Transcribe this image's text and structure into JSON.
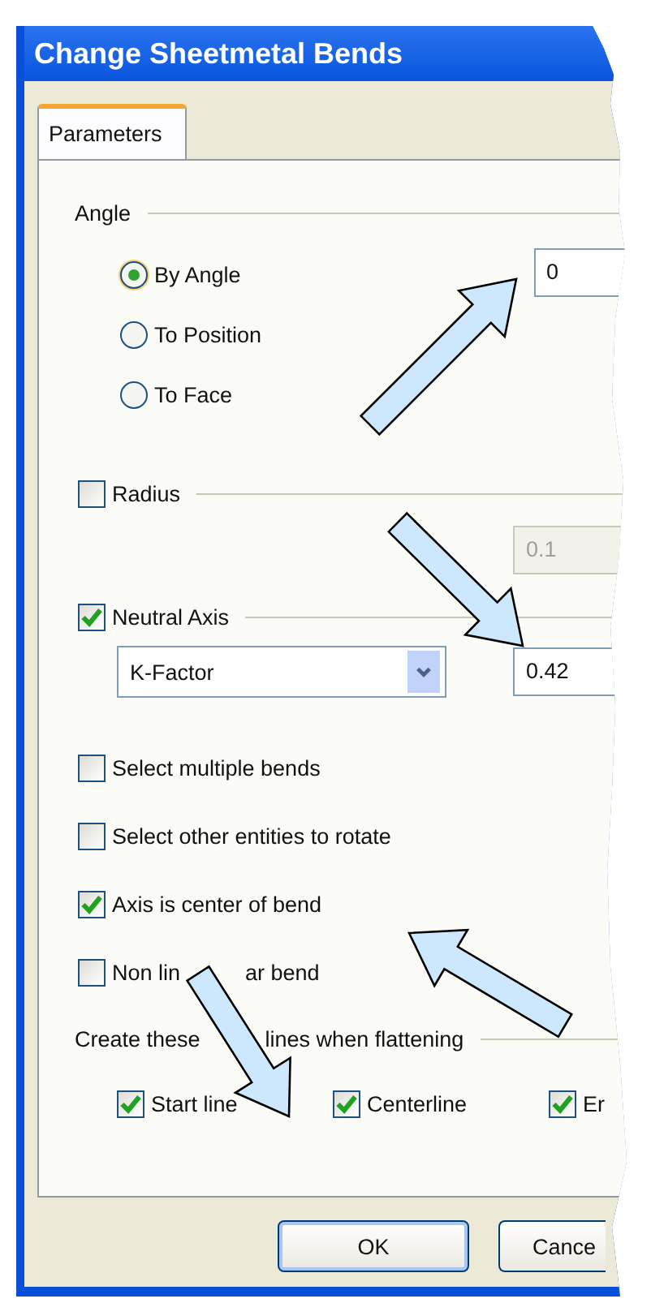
{
  "window": {
    "title": "Change Sheetmetal Bends"
  },
  "tabs": [
    {
      "label": "Parameters",
      "selected": true
    }
  ],
  "angle_group": {
    "title": "Angle",
    "value": "0",
    "options": [
      {
        "label": "By Angle",
        "selected": true
      },
      {
        "label": "To Position",
        "selected": false
      },
      {
        "label": "To Face",
        "selected": false
      }
    ]
  },
  "radius": {
    "label": "Radius",
    "checked": false,
    "value": "0.1",
    "disabled": true
  },
  "neutral_axis": {
    "label": "Neutral Axis",
    "checked": true,
    "method": "K-Factor",
    "value": "0.42"
  },
  "options": [
    {
      "label": [
        "Select multiple bends"
      ],
      "checked": false
    },
    {
      "label": [
        "Select other entities to rotate"
      ],
      "checked": false
    },
    {
      "label": [
        "Axis is center of bend"
      ],
      "checked": true
    },
    {
      "label": [
        "Non lin",
        "ar bend"
      ],
      "checked": false
    }
  ],
  "bend_lines": {
    "title": [
      "Create these",
      "lines when flattening"
    ],
    "items": [
      {
        "label": "Start line",
        "checked": true
      },
      {
        "label": "Centerline",
        "checked": true
      },
      {
        "label": "Er",
        "checked": true
      }
    ]
  },
  "buttons": [
    "OK",
    "Cance"
  ]
}
